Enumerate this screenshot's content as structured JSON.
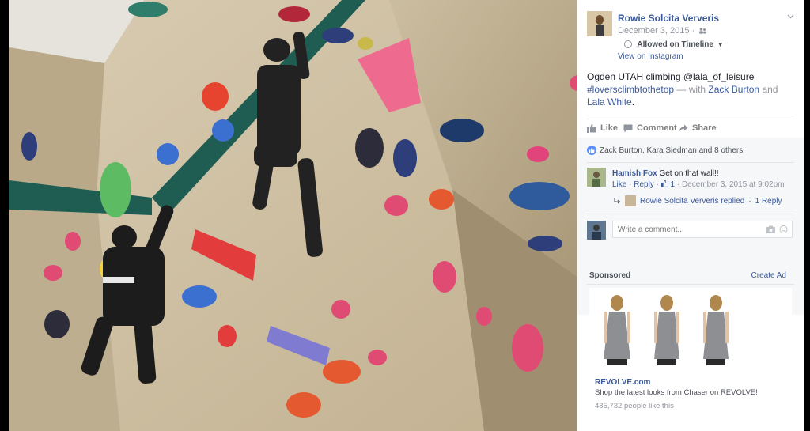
{
  "post": {
    "author_name": "Rowie Solcita Ververis",
    "date": "December 3, 2015 ·",
    "timeline_label": "Allowed on Timeline",
    "view_link": "View on Instagram",
    "caption_text": "Ogden UTAH climbing @lala_of_leisure",
    "caption_hashtag": "#loversclimbtothetop",
    "caption_with": " — with ",
    "caption_person1": "Zack Burton",
    "caption_and": " and ",
    "caption_person2": "Lala White",
    "caption_end": "."
  },
  "actions": {
    "like": "Like",
    "comment": "Comment",
    "share": "Share"
  },
  "likes_summary": "Zack Burton, Kara Siedman and 8 others",
  "comment": {
    "author": "Hamish Fox",
    "text": "Get on that wall!!",
    "like": "Like",
    "sep1": " · ",
    "reply": "Reply",
    "sep2": " · ",
    "like_count": "1",
    "timestamp": " · December 3, 2015 at 9:02pm"
  },
  "reply_summary": {
    "text": "Rowie Solcita Ververis replied",
    "sep": " · ",
    "count": "1 Reply"
  },
  "write_comment": {
    "placeholder": "Write a comment..."
  },
  "sponsored": {
    "heading": "Sponsored",
    "create_ad": "Create Ad",
    "title": "REVOLVE.com",
    "description": "Shop the latest looks from Chaser on REVOLVE!",
    "likes": "485,732 people like this"
  },
  "colors": {
    "link": "#3b5998",
    "like_badge": "#5890ff",
    "panel_bg": "#ffffff",
    "feedback_bg": "#f6f7f9"
  },
  "icons": [
    "chevron-down-icon",
    "friends-icon",
    "globe-icon",
    "caret-down-icon",
    "thumbs-up-icon",
    "comment-icon",
    "share-icon",
    "like-badge-icon",
    "reply-arrow-icon",
    "camera-icon",
    "smiley-icon"
  ]
}
